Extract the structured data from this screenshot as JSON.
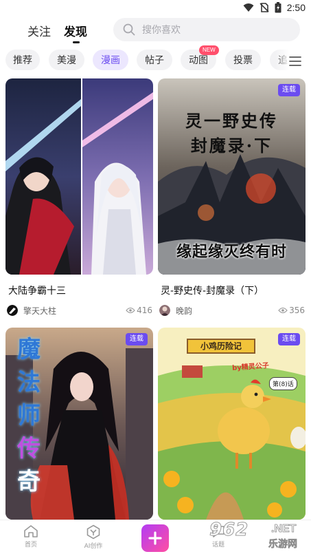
{
  "status_bar": {
    "time": "2:50"
  },
  "header": {
    "tabs": [
      {
        "label": "关注",
        "active": false
      },
      {
        "label": "发现",
        "active": true
      }
    ],
    "search": {
      "placeholder": "搜你喜欢"
    }
  },
  "categories": [
    {
      "label": "推荐",
      "active": false
    },
    {
      "label": "美漫",
      "active": false
    },
    {
      "label": "漫画",
      "active": true
    },
    {
      "label": "帖子",
      "active": false
    },
    {
      "label": "动图",
      "active": false,
      "badge": "NEW"
    },
    {
      "label": "投票",
      "active": false
    },
    {
      "label": "追",
      "active": false
    }
  ],
  "feed": [
    {
      "title": "大陆争霸十三",
      "author": "擎天大柱",
      "views": "416",
      "badge": ""
    },
    {
      "title": "灵-野史传-封魔录（下）",
      "author": "晚韵",
      "views": "356",
      "badge": "连载",
      "cover_text": [
        "灵一野史传",
        "封魔录·下",
        "缘起缘灭终有时"
      ]
    },
    {
      "title": "",
      "author": "",
      "views": "",
      "badge": "连载",
      "cover_text": [
        "魔",
        "法",
        "师",
        "传",
        "奇"
      ]
    },
    {
      "title": "",
      "author": "",
      "views": "",
      "badge": "连载",
      "cover_text": [
        "小鸡历险记",
        "by精灵公子",
        "第(8)话"
      ]
    }
  ],
  "bottom_nav": [
    {
      "label": "首页",
      "icon": "home-icon"
    },
    {
      "label": "AI创作",
      "icon": "ai-create-icon"
    },
    {
      "label": "",
      "icon": "plus-icon"
    },
    {
      "label": "话题",
      "icon": "topic-icon"
    }
  ],
  "watermark": {
    "number": "962",
    "domain": ".NET",
    "text": "乐游网"
  },
  "colors": {
    "accent": "#6b4cf0",
    "new_badge": "#ff4f6c",
    "chip_bg": "#f2f2f4"
  }
}
